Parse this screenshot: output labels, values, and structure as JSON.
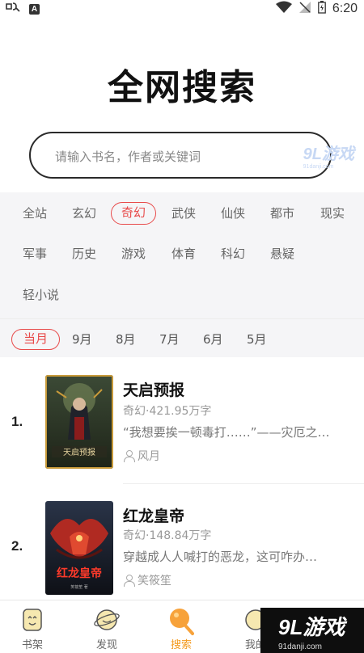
{
  "status_bar": {
    "time": "6:20",
    "left_icons": [
      "app-logo-icon",
      "text-a-icon"
    ],
    "right_icons": [
      "wifi-icon",
      "signal-off-icon",
      "battery-icon"
    ]
  },
  "title": "全网搜索",
  "search": {
    "placeholder": "请输入书名，作者或关键词"
  },
  "watermark": {
    "logo": "9L游戏",
    "url": "91danji.com"
  },
  "categories": {
    "items": [
      "全站",
      "玄幻",
      "奇幻",
      "武侠",
      "仙侠",
      "都市",
      "现实",
      "军事",
      "历史",
      "游戏",
      "体育",
      "科幻",
      "悬疑",
      "轻小说"
    ],
    "selected": "奇幻"
  },
  "months": {
    "items": [
      "当月",
      "9月",
      "8月",
      "7月",
      "6月",
      "5月"
    ],
    "selected": "当月"
  },
  "books": [
    {
      "rank": "1.",
      "title": "天启预报",
      "meta": "奇幻·421.95万字",
      "desc": "“我想要挨一顿毒打……”——灾厄之…",
      "author": "风月",
      "cover_colors": [
        "#2c3a2a",
        "#c89a3a"
      ]
    },
    {
      "rank": "2.",
      "title": "红龙皇帝",
      "meta": "奇幻·148.84万字",
      "desc": "穿越成人人喊打的恶龙，这可咋办…",
      "author": "笑筱笙",
      "cover_colors": [
        "#1a1e2a",
        "#c0302a"
      ]
    }
  ],
  "bottom_nav": [
    {
      "label": "书架",
      "icon": "bookshelf-icon"
    },
    {
      "label": "发现",
      "icon": "discover-icon"
    },
    {
      "label": "搜索",
      "icon": "search-icon",
      "active": true
    },
    {
      "label": "我的",
      "icon": "profile-icon"
    }
  ],
  "watermark_bottom": {
    "logo": "9L游戏",
    "url": "91danji.com"
  },
  "colors": {
    "accent": "#e84a4a",
    "nav_active": "#f39a1f"
  }
}
